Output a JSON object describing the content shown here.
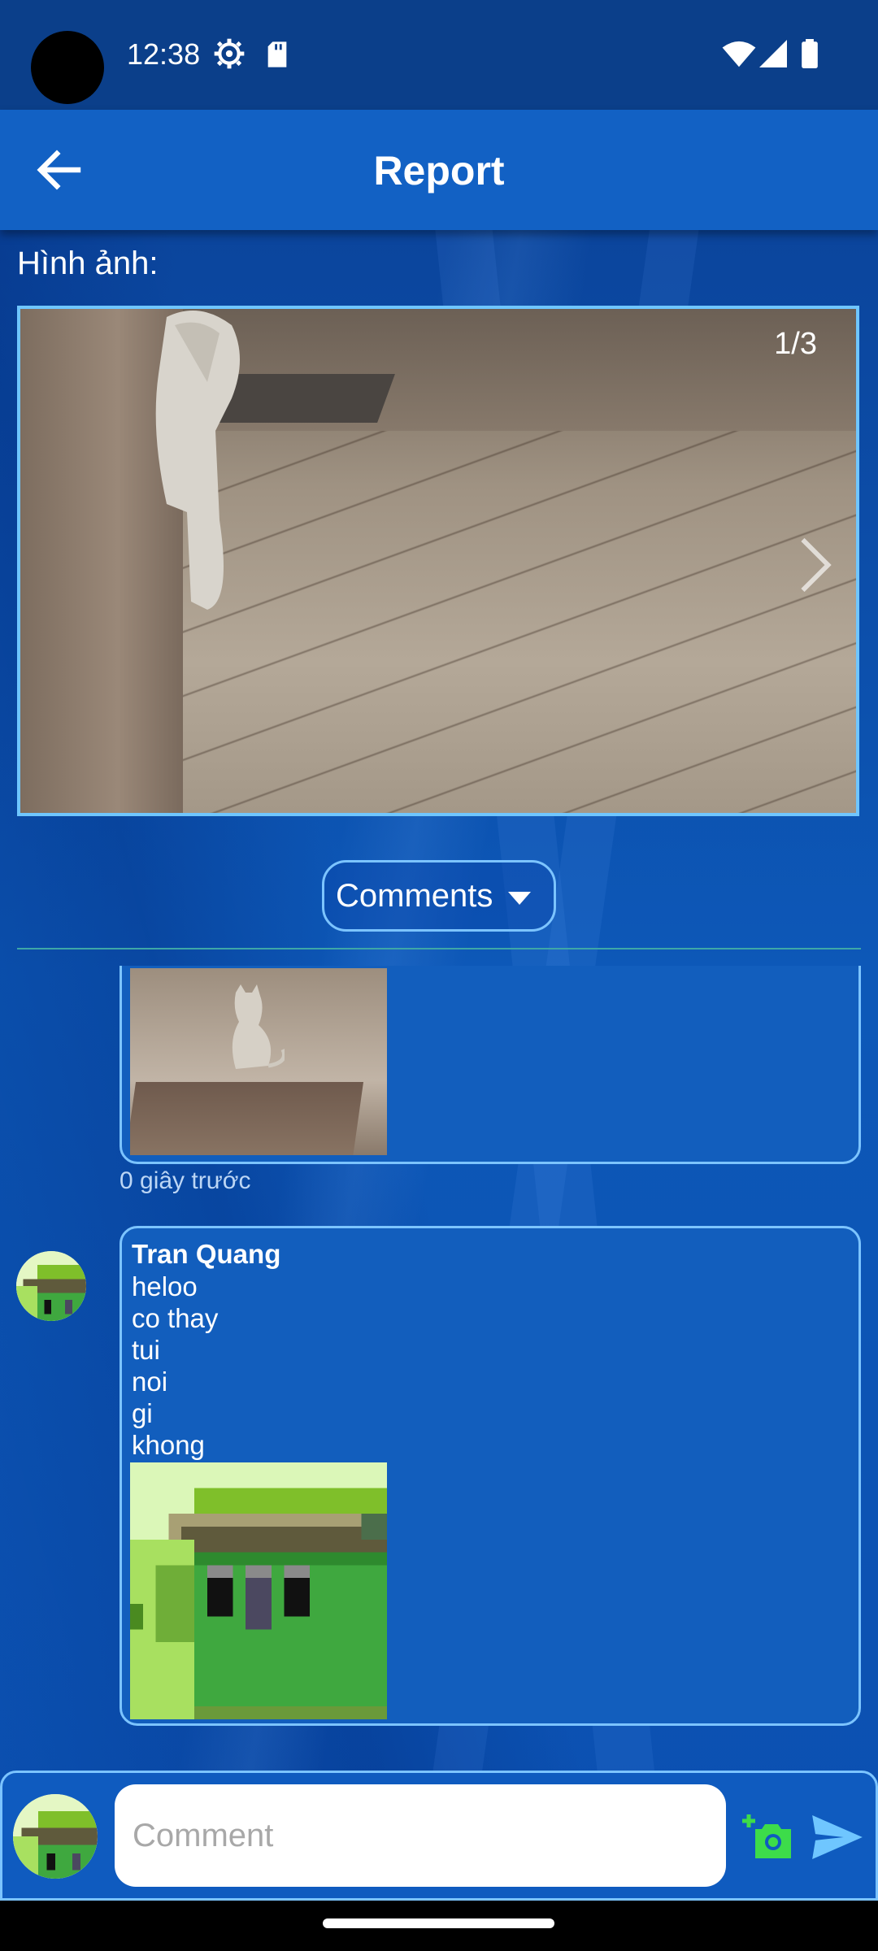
{
  "status_bar": {
    "time": "12:38",
    "icons": [
      "gear-icon",
      "sd-card-icon",
      "wifi-icon",
      "signal-icon",
      "battery-icon"
    ]
  },
  "app_bar": {
    "title": "Report",
    "back_icon": "arrow-left-icon"
  },
  "images_section": {
    "label": "Hình ảnh:",
    "counter": "1/3",
    "next_icon": "chevron-right-icon"
  },
  "comments_dropdown": {
    "selected": "Comments",
    "icon": "caret-down-icon"
  },
  "comments": [
    {
      "image": "cat-photo",
      "timestamp": "0 giây trước"
    },
    {
      "author": "Tran Quang",
      "lines": [
        "heloo",
        "co thay",
        "tui",
        "noi",
        "gi",
        "khong"
      ],
      "image": "pixel-art-avatar"
    }
  ],
  "composer": {
    "placeholder": "Comment",
    "add_photo_icon": "add-photo-icon",
    "send_icon": "send-icon"
  },
  "colors": {
    "accent_border": "#7cc4ff",
    "app_bar": "#1261c4",
    "bubble": "#125ebd",
    "camera_icon": "#3ddc4a"
  }
}
